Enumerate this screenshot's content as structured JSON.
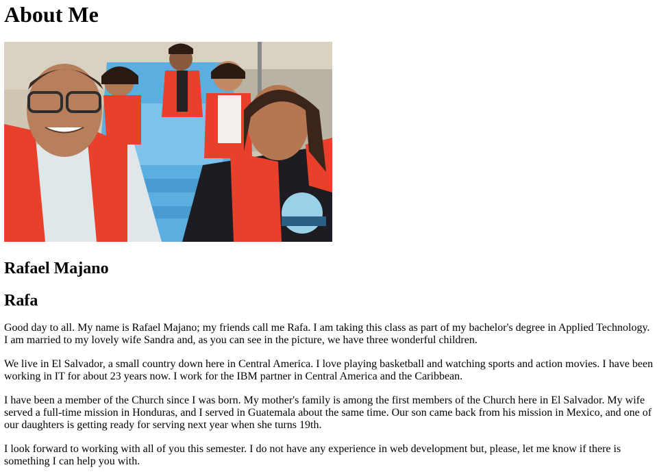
{
  "page": {
    "heading": "About Me"
  },
  "photo": {
    "alt": "Family selfie on a boat wearing life jackets"
  },
  "profile": {
    "name": "Rafael Majano",
    "nickname": "Rafa"
  },
  "bio": {
    "paragraphs": [
      "Good day to all. My name is Rafael Majano; my friends call me Rafa. I am taking this class as part of my bachelor's degree in Applied Technology. I am married to my lovely wife Sandra and, as you can see in the picture, we have three wonderful children.",
      "We live in El Salvador, a small country down here in Central America. I love playing basketball and watching sports and action movies. I have been working in IT for about 23 years now. I work for the IBM partner in Central America and the Caribbean.",
      "I have been a member of the Church since I was born. My mother's family is among the first members of the Church here in El Salvador. My wife served a full-time mission in Honduras, and I served in Guatemala about the same time. Our son came back from his mission in Mexico, and one of our daughters is getting ready for serving next year when she turns 19th.",
      "I look forward to working with all of you this semester. I do not have any experience in web development but, please, let me know if there is something I can help you with."
    ]
  },
  "colors": {
    "lifejacket": "#e8402a",
    "boat": "#5aaee0",
    "sand": "#cfc6b4"
  }
}
